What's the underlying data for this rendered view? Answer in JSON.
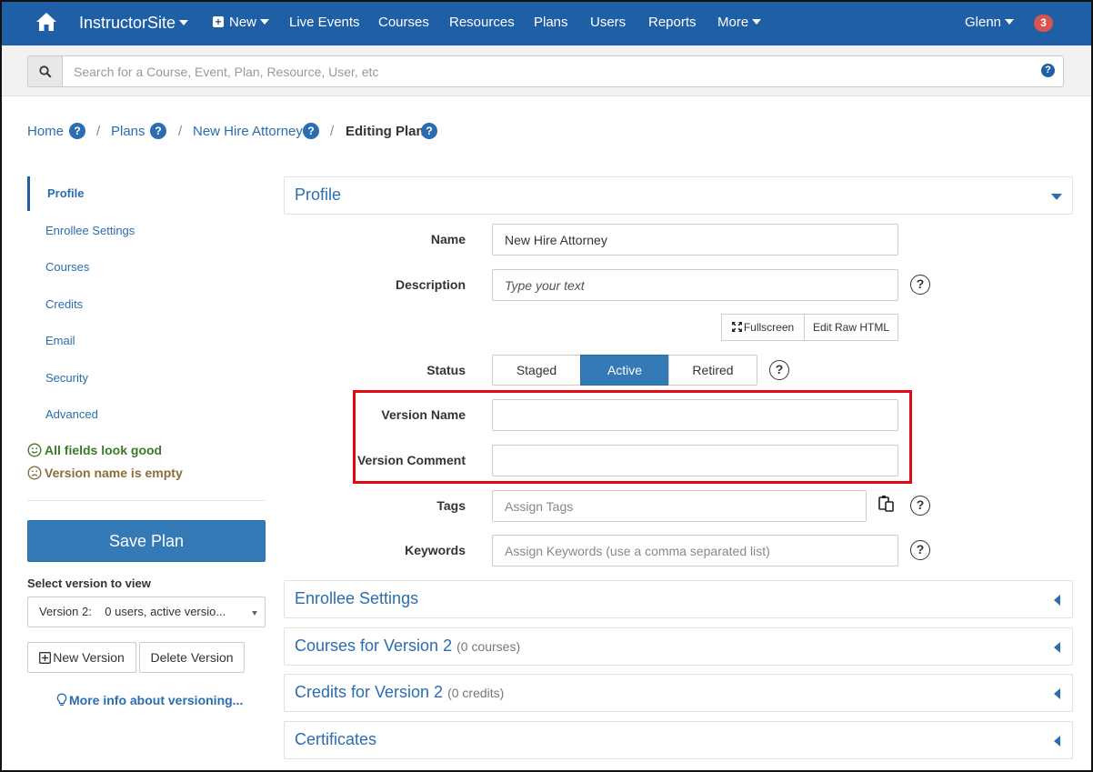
{
  "nav": {
    "brand": "InstructorSite",
    "new_label": "New",
    "items": [
      "Live Events",
      "Courses",
      "Resources",
      "Plans",
      "Users",
      "Reports"
    ],
    "more_label": "More",
    "user": "Glenn",
    "notifications": "3"
  },
  "search": {
    "placeholder": "Search for a Course, Event, Plan, Resource, User, etc",
    "help": "?"
  },
  "breadcrumb": {
    "items": [
      "Home",
      "Plans",
      "New Hire Attorney"
    ],
    "current": "Editing Plan",
    "separator": "/",
    "help": "?"
  },
  "sidebar": {
    "items": [
      "Profile",
      "Enrollee Settings",
      "Courses",
      "Credits",
      "Email",
      "Security",
      "Advanced"
    ],
    "status_good": "All fields look good",
    "status_warn": "Version name is empty",
    "save_label": "Save Plan",
    "select_label": "Select version to view",
    "version_selected": "Version 2:    0 users, active versio...",
    "new_version_label": "New Version",
    "delete_version_label": "Delete Version",
    "more_info": "More info about versioning..."
  },
  "profile": {
    "title": "Profile",
    "name_label": "Name",
    "name_value": "New Hire Attorney",
    "description_label": "Description",
    "description_placeholder": "Type your text",
    "fullscreen_label": "Fullscreen",
    "raw_html_label": "Edit Raw HTML",
    "status_label": "Status",
    "status_options": [
      "Staged",
      "Active",
      "Retired"
    ],
    "status_selected": "Active",
    "version_name_label": "Version Name",
    "version_name_value": "",
    "version_comment_label": "Version Comment",
    "version_comment_value": "",
    "tags_label": "Tags",
    "tags_placeholder": "Assign Tags",
    "keywords_label": "Keywords",
    "keywords_placeholder": "Assign Keywords (use a comma separated list)",
    "help": "?"
  },
  "panels": {
    "enrollee": "Enrollee Settings",
    "courses": "Courses for Version 2",
    "courses_count": "(0 courses)",
    "credits": "Credits for Version 2",
    "credits_count": "(0 credits)",
    "certificates": "Certificates"
  },
  "colors": {
    "nav_bg": "#1f5fa6",
    "link": "#2a6db0",
    "primary_button": "#337ab7",
    "highlight": "#e30613",
    "badge": "#d9534f"
  }
}
